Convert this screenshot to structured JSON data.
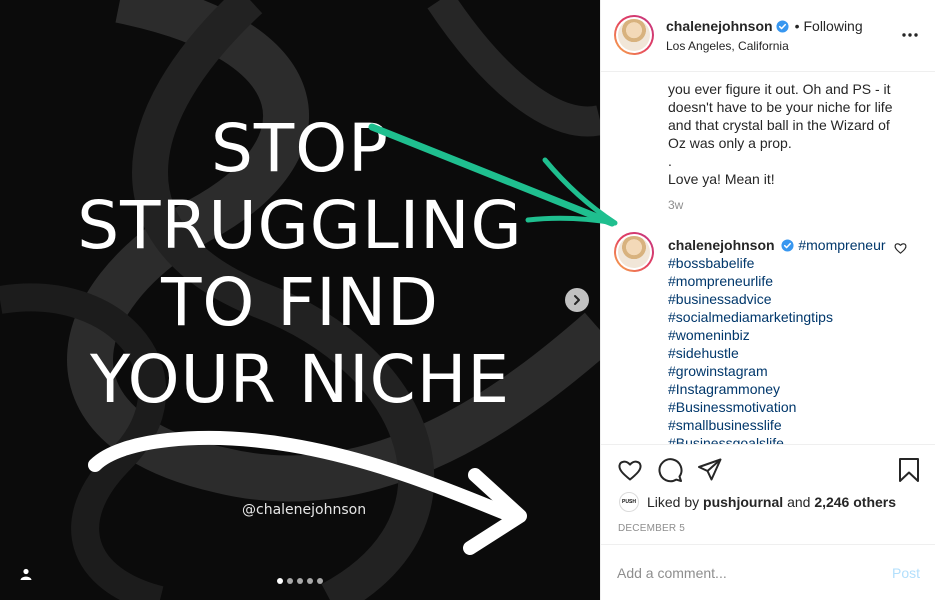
{
  "post_image": {
    "headline_lines": [
      "STOP",
      "STRUGGLING",
      "TO FIND",
      "YOUR NICHE"
    ],
    "handle": "@chalenejohnson",
    "carousel_count": 5,
    "carousel_active": 0
  },
  "header": {
    "username": "chalenejohnson",
    "separator": "•",
    "follow_label": "Following",
    "location": "Los Angeles, California"
  },
  "caption": {
    "lines": [
      "you ever figure it out. Oh and PS - it",
      "doesn't have to be your niche for life",
      "and that crystal ball in the Wizard of",
      "Oz was only a prop.",
      ".",
      "Love ya! Mean it!"
    ],
    "time_ago": "3w"
  },
  "comment": {
    "username": "chalenejohnson",
    "first_tag": "#mompreneur",
    "tags": [
      "#bossbabelife",
      "#mompreneurlife",
      "#businessadvice",
      "#socialmediamarketingtips",
      "#womeninbiz",
      "#sidehustle",
      "#growinstagram",
      "#Instagrammoney",
      "#Businessmotivation",
      "#smallbusinesslife",
      "#Businessgoalslife"
    ]
  },
  "likes": {
    "mini_avatar_text": "PUSH",
    "prefix": "Liked by",
    "user": "pushjournal",
    "and": "and",
    "count": "2,246 others"
  },
  "date": "DECEMBER 5",
  "add_comment": {
    "placeholder": "Add a comment...",
    "post_label": "Post"
  },
  "colors": {
    "link": "#00376b",
    "verified": "#3897f0",
    "green_arrow": "#1fbf8f"
  }
}
